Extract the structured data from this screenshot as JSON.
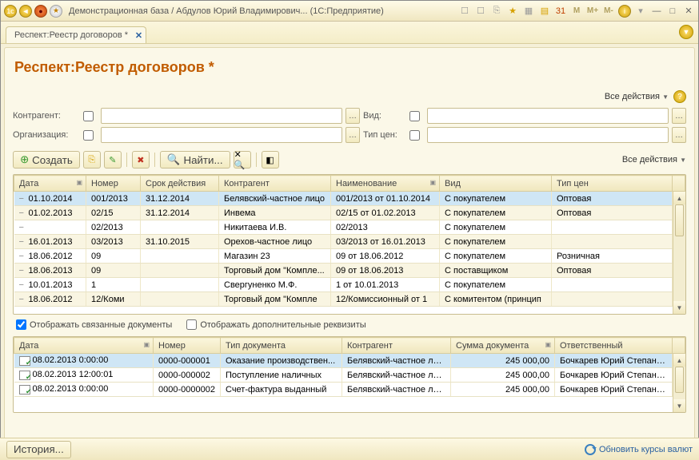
{
  "window": {
    "title": "Демонстрационная база / Абдулов Юрий Владимирович... (1С:Предприятие)"
  },
  "titlebar_icons": {
    "m": "M",
    "mplus": "M+",
    "mminus": "M-",
    "info": "i"
  },
  "tab": {
    "title": "Респект:Реестр договоров *"
  },
  "page": {
    "title": "Респект:Реестр договоров *",
    "all_actions": "Все действия"
  },
  "filters": {
    "counterparty_label": "Контрагент:",
    "organization_label": "Организация:",
    "kind_label": "Вид:",
    "price_type_label": "Тип цен:",
    "counterparty_value": "",
    "organization_value": "",
    "kind_value": "",
    "price_type_value": ""
  },
  "toolbar": {
    "create": "Создать",
    "find": "Найти...",
    "all_actions": "Все действия"
  },
  "grid1": {
    "cols": [
      "Дата",
      "Номер",
      "Срок действия",
      "Контрагент",
      "Наименование",
      "Вид",
      "Тип цен"
    ],
    "rows": [
      {
        "ico": "−",
        "c": [
          "01.10.2014",
          "001/2013",
          "31.12.2014",
          "Белявский-частное лицо",
          "001/2013 от 01.10.2014",
          "С покупателем",
          "Оптовая"
        ],
        "sel": true
      },
      {
        "ico": "−",
        "c": [
          "01.02.2013",
          "02/15",
          "31.12.2014",
          "Инвема",
          "02/15 от 01.02.2013",
          "С покупателем",
          "Оптовая"
        ]
      },
      {
        "ico": "−",
        "c": [
          "",
          "02/2013",
          "",
          "Никитаева И.В.",
          "02/2013",
          "С покупателем",
          ""
        ]
      },
      {
        "ico": "−",
        "c": [
          "16.01.2013",
          "03/2013",
          "31.10.2015",
          "Орехов-частное лицо",
          "03/2013 от 16.01.2013",
          "С покупателем",
          ""
        ]
      },
      {
        "ico": "−",
        "c": [
          "18.06.2012",
          "09",
          "",
          "Магазин 23",
          "09 от 18.06.2012",
          "С покупателем",
          "Розничная"
        ]
      },
      {
        "ico": "−",
        "c": [
          "18.06.2013",
          "09",
          "",
          "Торговый дом \"Компле...",
          "09 от 18.06.2013",
          "С поставщиком",
          "Оптовая"
        ]
      },
      {
        "ico": "−",
        "c": [
          "10.01.2013",
          "1",
          "",
          "Свергуненко М.Ф.",
          "1 от 10.01.2013",
          "С покупателем",
          ""
        ]
      },
      {
        "ico": "−",
        "c": [
          "18.06.2012",
          "12/Коми",
          "",
          "Торговый дом \"Компле",
          "12/Комиссионный от 1",
          "С комитентом (принцип",
          ""
        ]
      }
    ]
  },
  "midbar": {
    "show_linked": "Отображать связанные документы",
    "show_additional": "Отображать дополнительные реквизиты",
    "show_linked_checked": true,
    "show_additional_checked": false
  },
  "grid2": {
    "cols": [
      "Дата",
      "Номер",
      "Тип документа",
      "Контрагент",
      "Сумма документа",
      "Ответственный"
    ],
    "rows": [
      {
        "sel": true,
        "c": [
          "08.02.2013 0:00:00",
          "0000-000001",
          "Оказание производствен...",
          "Белявский-частное лицо",
          "245 000,00",
          "Бочкарев Юрий Степанович"
        ]
      },
      {
        "c": [
          "08.02.2013 12:00:01",
          "0000-000002",
          "Поступление наличных",
          "Белявский-частное лицо",
          "245 000,00",
          "Бочкарев Юрий Степанович"
        ]
      },
      {
        "c": [
          "08.02.2013 0:00:00",
          "0000-0000002",
          "Счет-фактура выданный",
          "Белявский-частное лицо",
          "245 000,00",
          "Бочкарев Юрий Степанович"
        ]
      }
    ]
  },
  "bottombar": {
    "history": "История...",
    "refresh": "Обновить курсы валют"
  }
}
